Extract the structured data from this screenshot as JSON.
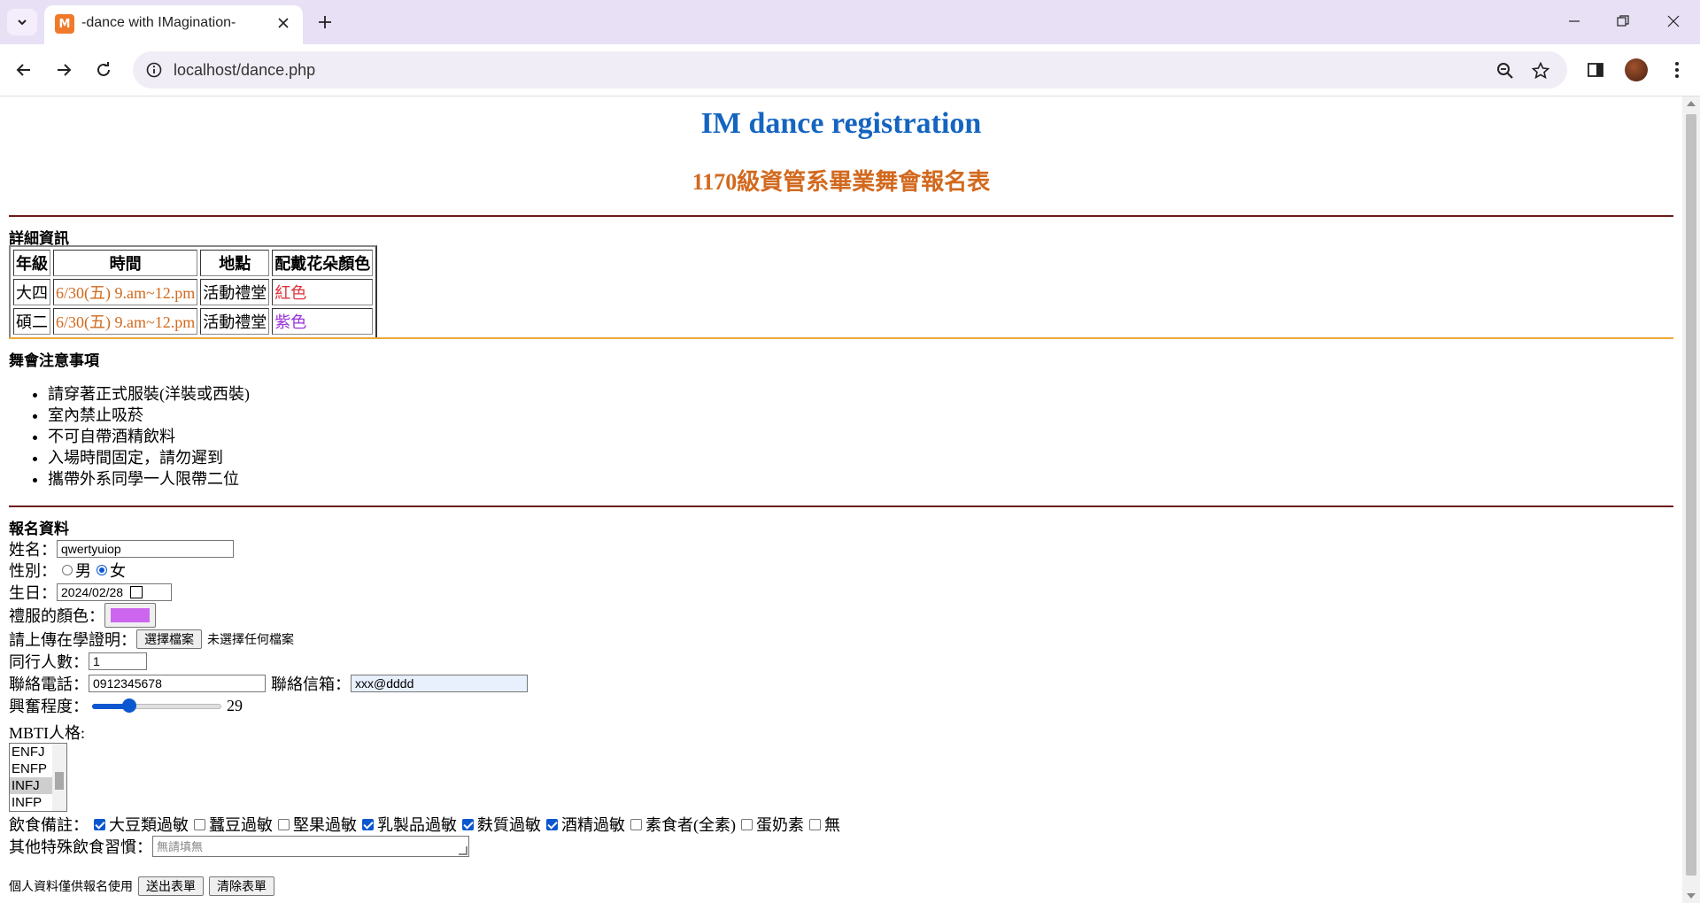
{
  "browser": {
    "tab_title": "-dance with IMagination-",
    "favicon_text": "M",
    "url": "localhost/dance.php"
  },
  "page": {
    "title": "IM dance registration",
    "subtitle": "1170級資管系畢業舞會報名表",
    "details_heading": "詳細資訊",
    "table": {
      "headers": [
        "年級",
        "時間",
        "地點",
        "配戴花朵顏色"
      ],
      "rows": [
        {
          "grade": "大四",
          "time": "6/30(五) 9.am~12.pm",
          "place": "活動禮堂",
          "flower": "紅色",
          "flower_color": "#e0303a"
        },
        {
          "grade": "碩二",
          "time": "6/30(五) 9.am~12.pm",
          "place": "活動禮堂",
          "flower": "紫色",
          "flower_color": "#9b30d9"
        }
      ]
    },
    "notes_heading": "舞會注意事項",
    "notes": [
      "請穿著正式服裝(洋裝或西裝)",
      "室內禁止吸菸",
      "不可自帶酒精飲料",
      "入場時間固定，請勿遲到",
      "攜帶外系同學一人限帶二位"
    ],
    "form_heading": "報名資料",
    "form": {
      "name_label": "姓名：",
      "name_value": "qwertyuiop",
      "gender_label": "性別：",
      "gender_male": "男",
      "gender_female": "女",
      "gender_selected": "女",
      "birthday_label": "生日：",
      "birthday_value": "2024/02/28",
      "dress_color_label": "禮服的顏色：",
      "dress_color_value": "#cc66ee",
      "upload_label": "請上傳在學證明：",
      "upload_button": "選擇檔案",
      "upload_status": "未選擇任何檔案",
      "companions_label": "同行人數：",
      "companions_value": "1",
      "phone_label": "聯絡電話：",
      "phone_value": "0912345678",
      "email_label": "聯絡信箱：",
      "email_value": "xxx@dddd",
      "excitement_label": "興奮程度：",
      "excitement_value": "29",
      "excitement_fraction": 0.29,
      "mbti_label": "MBTI人格:",
      "mbti_options": [
        "ENFJ",
        "ENFP",
        "INFJ",
        "INFP"
      ],
      "mbti_selected": "INFJ",
      "diet_label": "飲食備註：",
      "diet_options": [
        {
          "label": "大豆類過敏",
          "checked": true
        },
        {
          "label": "蠶豆過敏",
          "checked": false
        },
        {
          "label": "堅果過敏",
          "checked": false
        },
        {
          "label": "乳製品過敏",
          "checked": true
        },
        {
          "label": "麩質過敏",
          "checked": true
        },
        {
          "label": "酒精過敏",
          "checked": true
        },
        {
          "label": "素食者(全素)",
          "checked": false
        },
        {
          "label": "蛋奶素",
          "checked": false
        },
        {
          "label": "無",
          "checked": false
        }
      ],
      "other_diet_label": "其他特殊飲食習慣：",
      "other_diet_placeholder": "無請填無",
      "privacy_note": "個人資料僅供報名使用",
      "submit_button": "送出表單",
      "reset_button": "清除表單"
    },
    "colors": {
      "title": "#1565c0",
      "subtitle": "#d2691e",
      "hr1": "#6b1a1a",
      "hr2": "#e8a838",
      "hr3": "#6b1a1a"
    }
  }
}
